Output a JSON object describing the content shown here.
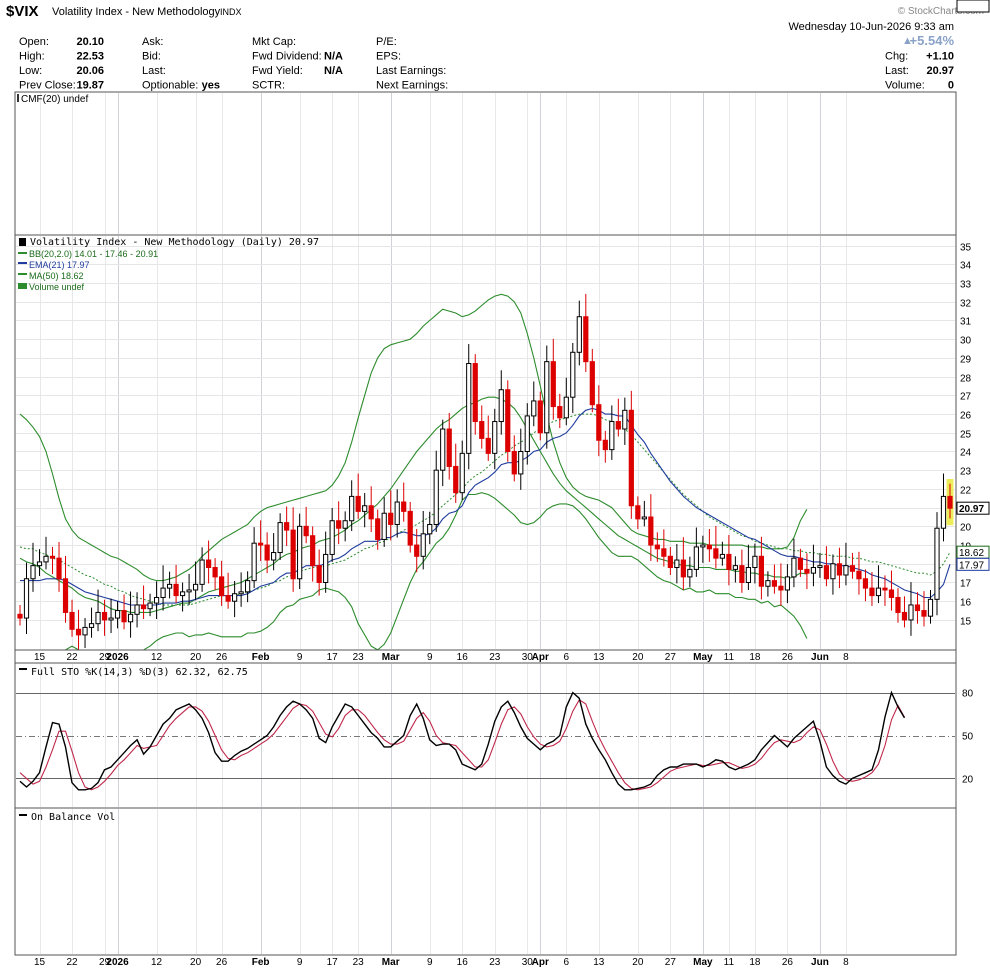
{
  "header": {
    "symbol": "$VIX",
    "name": "Volatility Index - New Methodology",
    "exchange": "INDX",
    "date": "Wednesday  10-Jun-2026  9:33 am",
    "watermark": "© StockCharts.com"
  },
  "quote": {
    "col1": [
      [
        "Open:",
        "20.10"
      ],
      [
        "High:",
        "22.53"
      ],
      [
        "Low:",
        "20.06"
      ],
      [
        "Prev Close:",
        "19.87"
      ]
    ],
    "col2": [
      [
        "Ask:",
        ""
      ],
      [
        "Bid:",
        ""
      ],
      [
        "Last:",
        ""
      ],
      [
        "Optionable:",
        "yes"
      ]
    ],
    "col3": [
      [
        "Mkt Cap:",
        ""
      ],
      [
        "Fwd Dividend:",
        "N/A"
      ],
      [
        "Fwd Yield:",
        "N/A"
      ],
      [
        "SCTR:",
        ""
      ]
    ],
    "col4": [
      [
        "P/E:",
        ""
      ],
      [
        "EPS:",
        ""
      ],
      [
        "Last Earnings:",
        ""
      ],
      [
        "Next Earnings:",
        ""
      ]
    ],
    "change_pct": "+5.54%",
    "col5": [
      [
        "Chg:",
        "+1.10"
      ],
      [
        "Last:",
        "20.97"
      ],
      [
        "Volume:",
        "0"
      ]
    ]
  },
  "panels": {
    "cmf_label": "CMF(20) undef",
    "price_label": "Volatility Index - New Methodology (Daily) 20.97",
    "legend": [
      "BB(20,2.0) 14.01 - 17.46 - 20.91",
      "EMA(21) 17.97",
      "MA(50) 18.62",
      "Volume undef"
    ],
    "sto_label": "Full STO %K(14,3) %D(3) 62.32, 62.75",
    "obv_label": "On Balance Vol"
  },
  "colors": {
    "up": "#000000",
    "down": "#dd0000",
    "bb": "#2d8c2d",
    "ema": "#1f3c9e",
    "ma50": "#2d8c2d",
    "stoK": "#000000",
    "stoD": "#c0284a",
    "highlight": "#eded5a"
  },
  "chart_data": [
    {
      "type": "candlestick",
      "title": "Volatility Index - New Methodology (Daily) 20.97",
      "ylim": [
        13.5,
        35.3
      ],
      "y_ticks": [
        15,
        16,
        17,
        18,
        19,
        20,
        21,
        22,
        23,
        24,
        25,
        26,
        27,
        28,
        29,
        30,
        31,
        32,
        33,
        34,
        35
      ],
      "x_ticks": [
        "15",
        "22",
        "29",
        "2026",
        "12",
        "20",
        "26",
        "Feb",
        "9",
        "17",
        "23",
        "Mar",
        "9",
        "16",
        "23",
        "30",
        "Apr",
        "6",
        "13",
        "20",
        "27",
        "May",
        "11",
        "18",
        "26",
        "Jun",
        "8"
      ],
      "value_tags": [
        "20.97",
        "18.62",
        "17.97",
        "17.46",
        "14.01"
      ],
      "close": [
        15.1,
        17.2,
        17.9,
        18.1,
        18.4,
        18.3,
        17.2,
        15.4,
        14.5,
        14.2,
        14.6,
        14.8,
        15.4,
        15.0,
        15.1,
        15.5,
        14.9,
        15.3,
        15.8,
        15.6,
        15.9,
        16.2,
        16.7,
        16.9,
        16.3,
        16.5,
        16.6,
        16.9,
        18.2,
        17.8,
        17.3,
        16.3,
        16.0,
        16.4,
        16.5,
        17.1,
        19.1,
        19.0,
        18.2,
        18.6,
        20.2,
        19.8,
        17.2,
        20.0,
        19.5,
        17.9,
        17.0,
        18.5,
        20.3,
        19.9,
        20.3,
        21.6,
        20.8,
        21.1,
        20.4,
        19.3,
        20.7,
        20.1,
        21.3,
        20.8,
        19.0,
        18.4,
        19.6,
        20.1,
        23.0,
        25.2,
        23.2,
        21.8,
        23.9,
        28.7,
        25.6,
        24.7,
        23.9,
        25.6,
        27.3,
        24.0,
        22.8,
        24.0,
        25.9,
        26.7,
        25.0,
        28.8,
        26.4,
        25.8,
        26.9,
        29.3,
        31.2,
        28.8,
        26.5,
        24.6,
        24.1,
        25.6,
        25.2,
        26.2,
        21.1,
        20.4,
        20.5,
        19.0,
        18.8,
        18.4,
        17.8,
        18.2,
        17.3,
        17.7,
        18.9,
        19.0,
        18.8,
        18.3,
        18.5,
        17.7,
        17.9,
        17.0,
        17.8,
        18.4,
        16.8,
        17.1,
        16.8,
        16.6,
        17.3,
        18.3,
        17.7,
        17.5,
        17.8,
        17.9,
        17.2,
        18.0,
        17.4,
        17.9,
        17.6,
        17.2,
        16.7,
        16.3,
        16.7,
        16.6,
        16.2,
        15.4,
        15.0,
        15.8,
        15.5,
        15.2,
        16.1,
        19.9,
        21.6,
        20.97
      ],
      "bb_middle": [
        18.3,
        18.1,
        18.0,
        17.8,
        17.5,
        17.3,
        17.1,
        16.9,
        16.7,
        16.4,
        16.2,
        16.1,
        16.0,
        15.8,
        15.6,
        15.5,
        15.5,
        15.4,
        15.4,
        15.4,
        15.4,
        15.5,
        15.6,
        15.7,
        15.8,
        15.9,
        15.9,
        16.1,
        16.3,
        16.5,
        16.6,
        16.7,
        16.8,
        16.9,
        17.0,
        17.2,
        17.4,
        17.6,
        17.8,
        18.0,
        18.3,
        18.5,
        18.6,
        18.8,
        18.9,
        19.0,
        19.2,
        19.3,
        19.4,
        19.6,
        19.8,
        20.1,
        20.3,
        20.6,
        20.9,
        21.2,
        21.6,
        22.0,
        22.5,
        23.0,
        23.5,
        24.0,
        24.4,
        24.8,
        25.2,
        25.5,
        25.7,
        26.0,
        26.3,
        26.5,
        26.6,
        26.8,
        26.9,
        26.9,
        26.8,
        26.6,
        26.3,
        25.8,
        25.2,
        24.6,
        24.0,
        23.4,
        22.8,
        22.3,
        21.9,
        21.6,
        21.3,
        21.0,
        20.7,
        20.4,
        20.1,
        19.8,
        19.5,
        19.3,
        19.1,
        18.9,
        18.7,
        18.5,
        18.3,
        18.2,
        18.1,
        18.0,
        17.9,
        17.9,
        17.8,
        17.8,
        17.8,
        17.7,
        17.7,
        17.7,
        17.6,
        17.6,
        17.5,
        17.5,
        17.4,
        17.4,
        17.3,
        17.3,
        17.2,
        17.3,
        17.5,
        17.46
      ],
      "bb_upper": [
        26.0,
        25.7,
        25.3,
        24.8,
        24.0,
        22.8,
        21.5,
        20.4,
        19.8,
        19.4,
        19.2,
        19.0,
        18.8,
        18.6,
        18.4,
        18.3,
        18.1,
        17.9,
        17.7,
        17.4,
        17.2,
        17.1,
        17.1,
        17.2,
        17.3,
        17.5,
        17.7,
        18.0,
        18.4,
        18.7,
        19.0,
        19.3,
        19.5,
        19.7,
        19.9,
        20.1,
        20.5,
        20.8,
        21.0,
        21.1,
        21.2,
        21.3,
        21.4,
        21.5,
        21.6,
        21.7,
        21.8,
        21.9,
        22.2,
        22.7,
        23.4,
        24.5,
        25.8,
        27.0,
        28.2,
        29.0,
        29.5,
        29.7,
        29.8,
        29.9,
        30.0,
        30.3,
        30.7,
        31.0,
        31.3,
        31.6,
        31.5,
        31.4,
        31.2,
        31.3,
        31.5,
        31.8,
        32.1,
        32.3,
        32.4,
        32.3,
        32.0,
        31.4,
        30.3,
        29.0,
        27.5,
        25.9,
        24.5,
        23.4,
        22.6,
        22.1,
        21.8,
        21.6,
        21.5,
        21.4,
        21.2,
        21.0,
        20.6,
        20.2,
        19.8,
        19.6,
        19.5,
        19.4,
        19.3,
        19.3,
        19.2,
        19.2,
        19.2,
        19.1,
        19.1,
        19.1,
        19.0,
        19.0,
        19.0,
        19.0,
        19.0,
        19.0,
        18.9,
        18.9,
        18.9,
        18.8,
        18.8,
        18.8,
        18.9,
        19.4,
        20.3,
        20.91
      ],
      "bb_lower": [
        10.6,
        10.5,
        10.7,
        10.8,
        11.0,
        11.8,
        12.7,
        13.4,
        13.6,
        13.4,
        13.2,
        13.2,
        13.2,
        13.0,
        12.8,
        12.7,
        12.9,
        12.9,
        13.1,
        13.4,
        13.6,
        13.9,
        14.1,
        14.2,
        14.3,
        14.3,
        14.1,
        14.2,
        14.2,
        14.3,
        14.2,
        14.1,
        14.1,
        14.1,
        14.1,
        14.3,
        14.3,
        14.4,
        14.6,
        14.9,
        15.4,
        15.7,
        15.8,
        16.1,
        16.2,
        16.3,
        16.6,
        16.7,
        16.6,
        16.5,
        16.2,
        15.7,
        14.8,
        14.2,
        13.6,
        13.4,
        13.7,
        14.3,
        15.2,
        16.1,
        17.0,
        17.7,
        18.1,
        18.6,
        19.1,
        19.4,
        19.9,
        20.6,
        21.4,
        21.7,
        21.7,
        21.8,
        21.7,
        21.5,
        21.2,
        20.9,
        20.6,
        20.2,
        20.1,
        20.2,
        20.5,
        20.9,
        21.1,
        21.2,
        21.2,
        21.1,
        20.8,
        20.4,
        19.9,
        19.4,
        19.0,
        18.6,
        18.4,
        18.4,
        18.4,
        18.2,
        17.9,
        17.6,
        17.3,
        17.1,
        17.0,
        16.8,
        16.6,
        16.7,
        16.5,
        16.5,
        16.6,
        16.4,
        16.4,
        16.4,
        16.2,
        16.2,
        16.1,
        16.1,
        15.9,
        16.0,
        15.7,
        15.8,
        15.5,
        15.2,
        14.7,
        14.01
      ],
      "ema21": [
        17.1,
        17.1,
        17.1,
        17.1,
        17.2,
        17.2,
        17.2,
        17.1,
        16.9,
        16.7,
        16.5,
        16.4,
        16.3,
        16.2,
        16.1,
        16.0,
        15.9,
        15.8,
        15.8,
        15.8,
        15.8,
        15.8,
        15.9,
        15.9,
        15.9,
        16.0,
        16.0,
        16.1,
        16.2,
        16.3,
        16.3,
        16.3,
        16.3,
        16.3,
        16.3,
        16.4,
        16.6,
        16.8,
        16.9,
        17.0,
        17.3,
        17.5,
        17.5,
        17.7,
        17.9,
        17.9,
        17.9,
        18.0,
        18.2,
        18.3,
        18.5,
        18.8,
        19.0,
        19.2,
        19.2,
        19.2,
        19.4,
        19.4,
        19.6,
        19.7,
        19.6,
        19.5,
        19.5,
        19.6,
        19.9,
        20.4,
        20.7,
        20.8,
        21.1,
        21.8,
        22.2,
        22.4,
        22.6,
        22.9,
        23.3,
        23.4,
        23.4,
        23.5,
        23.7,
        24.0,
        24.1,
        24.5,
        24.7,
        24.8,
        25.0,
        25.4,
        25.9,
        26.2,
        26.3,
        26.2,
        26.0,
        26.0,
        25.9,
        25.9,
        25.4,
        24.9,
        24.5,
        23.9,
        23.4,
        22.9,
        22.4,
        22.0,
        21.6,
        21.3,
        21.0,
        20.8,
        20.6,
        20.4,
        20.2,
        20.0,
        19.8,
        19.6,
        19.4,
        19.3,
        19.1,
        18.9,
        18.7,
        18.5,
        18.4,
        18.4,
        18.3,
        18.2,
        18.1,
        18.1,
        18.0,
        18.0,
        17.9,
        17.9,
        17.8,
        17.7,
        17.6,
        17.4,
        17.3,
        17.2,
        17.0,
        16.8,
        16.6,
        16.5,
        16.4,
        16.2,
        16.2,
        16.5,
        16.9,
        17.97
      ],
      "ma50": [
        18.9,
        18.8,
        18.8,
        18.6,
        18.5,
        18.3,
        18.2,
        18.0,
        17.8,
        17.6,
        17.4,
        17.3,
        17.1,
        16.9,
        16.8,
        16.6,
        16.5,
        16.3,
        16.2,
        16.1,
        16.0,
        15.9,
        15.8,
        15.8,
        15.8,
        15.8,
        15.8,
        15.9,
        16.0,
        16.1,
        16.2,
        16.3,
        16.3,
        16.3,
        16.4,
        16.5,
        16.6,
        16.7,
        16.8,
        17.0,
        17.1,
        17.3,
        17.4,
        17.6,
        17.7,
        17.8,
        17.8,
        17.9,
        18.0,
        18.1,
        18.2,
        18.4,
        18.6,
        18.8,
        18.9,
        19.1,
        19.2,
        19.4,
        19.6,
        19.8,
        19.9,
        20.1,
        20.3,
        20.5,
        20.8,
        21.1,
        21.4,
        21.7,
        22.0,
        22.4,
        22.7,
        22.9,
        23.2,
        23.5,
        23.8,
        24.0,
        24.3,
        24.5,
        24.7,
        25.0,
        25.2,
        25.4,
        25.6,
        25.7,
        25.8,
        25.9,
        26.0,
        26.0,
        26.0,
        25.9,
        25.7,
        25.6,
        25.4,
        25.2,
        24.9,
        24.5,
        24.1,
        23.7,
        23.3,
        22.9,
        22.5,
        22.1,
        21.7,
        21.4,
        21.1,
        20.8,
        20.5,
        20.3,
        20.1,
        19.9,
        19.7,
        19.5,
        19.4,
        19.2,
        19.1,
        19.0,
        18.9,
        18.8,
        18.8,
        18.7,
        18.7,
        18.6,
        18.6,
        18.5,
        18.5,
        18.4,
        18.4,
        18.4,
        18.3,
        18.3,
        18.2,
        18.1,
        18.1,
        18.0,
        17.9,
        17.8,
        17.7,
        17.6,
        17.5,
        17.5,
        17.4,
        17.6,
        18.0,
        18.62
      ],
      "highlight_last": {
        "high": 22.53,
        "low": 20.06
      }
    },
    {
      "type": "line",
      "title": "Full STO %K(14,3) %D(3) 62.32, 62.75",
      "ylim": [
        0,
        100
      ],
      "y_ticks": [
        20,
        50,
        80
      ],
      "value_tags": [
        "62.32"
      ],
      "series": [
        {
          "name": "%K",
          "values": [
            18,
            14,
            18,
            24,
            42,
            59,
            58,
            42,
            17,
            12,
            12,
            13,
            17,
            26,
            28,
            33,
            38,
            43,
            47,
            37,
            42,
            50,
            58,
            62,
            68,
            70,
            72,
            68,
            62,
            52,
            38,
            32,
            32,
            36,
            39,
            41,
            44,
            47,
            50,
            56,
            64,
            70,
            74,
            72,
            68,
            62,
            48,
            45,
            56,
            64,
            72,
            70,
            64,
            58,
            52,
            48,
            42,
            42,
            46,
            50,
            64,
            72,
            62,
            47,
            43,
            44,
            44,
            40,
            30,
            28,
            26,
            30,
            44,
            60,
            70,
            74,
            66,
            56,
            48,
            44,
            40,
            44,
            46,
            50,
            70,
            80,
            76,
            58,
            48,
            40,
            33,
            24,
            16,
            12,
            12,
            13,
            14,
            16,
            22,
            26,
            28,
            28,
            30,
            30,
            30,
            28,
            30,
            33,
            32,
            28,
            26,
            28,
            30,
            33,
            40,
            45,
            50,
            46,
            42,
            48,
            52,
            56,
            60,
            46,
            28,
            22,
            18,
            16,
            20,
            22,
            24,
            26,
            40,
            63,
            80,
            70,
            62.32
          ]
        },
        {
          "name": "%D",
          "values": [
            24,
            20,
            16,
            18,
            28,
            40,
            53,
            53,
            39,
            24,
            14,
            12,
            14,
            18,
            23,
            29,
            33,
            38,
            43,
            41,
            42,
            43,
            50,
            57,
            62,
            66,
            70,
            70,
            67,
            60,
            50,
            40,
            34,
            33,
            36,
            38,
            41,
            44,
            47,
            51,
            57,
            63,
            69,
            72,
            71,
            67,
            59,
            51,
            49,
            55,
            64,
            68,
            68,
            64,
            58,
            52,
            47,
            44,
            44,
            46,
            54,
            62,
            66,
            60,
            50,
            45,
            44,
            43,
            38,
            33,
            28,
            28,
            33,
            45,
            58,
            68,
            70,
            65,
            56,
            49,
            44,
            42,
            43,
            46,
            55,
            67,
            75,
            72,
            60,
            49,
            40,
            32,
            24,
            17,
            13,
            12,
            13,
            14,
            17,
            21,
            25,
            27,
            28,
            29,
            30,
            29,
            29,
            30,
            31,
            31,
            29,
            27,
            28,
            30,
            34,
            40,
            45,
            47,
            46,
            45,
            47,
            52,
            56,
            54,
            44,
            32,
            23,
            19,
            18,
            19,
            21,
            24,
            30,
            43,
            61,
            71,
            62.75
          ]
        }
      ]
    }
  ]
}
